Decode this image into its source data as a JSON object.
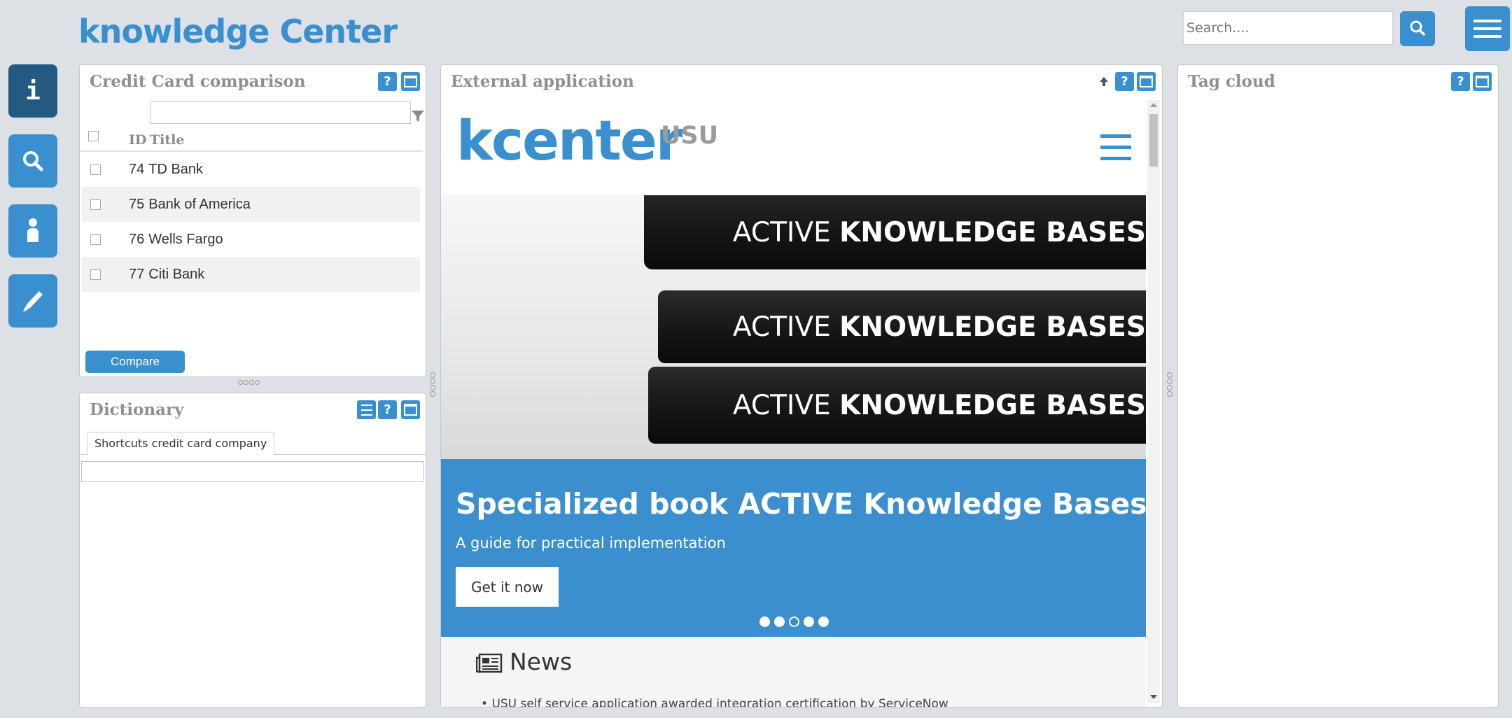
{
  "header": {
    "logo_text": "knowledge Center",
    "search_placeholder": "Search....",
    "search_icon": "search-icon",
    "menu_icon": "hamburger-menu-icon"
  },
  "rail": {
    "items": [
      {
        "name": "info",
        "icon": "info-icon",
        "active": true
      },
      {
        "name": "search",
        "icon": "search-icon",
        "active": false
      },
      {
        "name": "user",
        "icon": "person-icon",
        "active": false
      },
      {
        "name": "edit",
        "icon": "pencil-icon",
        "active": false
      }
    ]
  },
  "credit_card_panel": {
    "title": "Credit Card comparison",
    "help_label": "?",
    "filter_value": "",
    "filter_icon": "filter-icon",
    "columns": [
      "ID",
      "Title"
    ],
    "rows": [
      {
        "id": "74",
        "title": "TD Bank"
      },
      {
        "id": "75",
        "title": "Bank of America"
      },
      {
        "id": "76",
        "title": "Wells Fargo"
      },
      {
        "id": "77",
        "title": "Citi Bank"
      }
    ],
    "compare_label": "Compare"
  },
  "dictionary_panel": {
    "title": "Dictionary",
    "help_label": "?",
    "tab_label": "Shortcuts credit card company",
    "input_value": ""
  },
  "external_panel": {
    "title": "External application",
    "help_label": "?",
    "site_logo": "kcenter",
    "site_logo_suffix": "USU",
    "book_text_light": "ACTIVE",
    "book_text_bold": "KNOWLEDGE BASES",
    "banner_title": "Specialized book ACTIVE Knowledge Bases",
    "banner_subtitle": "A guide for practical implementation",
    "banner_button": "Get it now",
    "carousel_dots": 5,
    "carousel_active_index": 2,
    "news_title": "News",
    "news_icon": "newspaper-icon",
    "news_items": [
      "USU self service application awarded integration certification by ServiceNow"
    ]
  },
  "tag_cloud_panel": {
    "title": "Tag cloud",
    "help_label": "?"
  },
  "colors": {
    "accent": "#3a8fce",
    "accent_dark": "#245a82",
    "background": "#dde1e5",
    "banner": "#3b8fcf"
  }
}
